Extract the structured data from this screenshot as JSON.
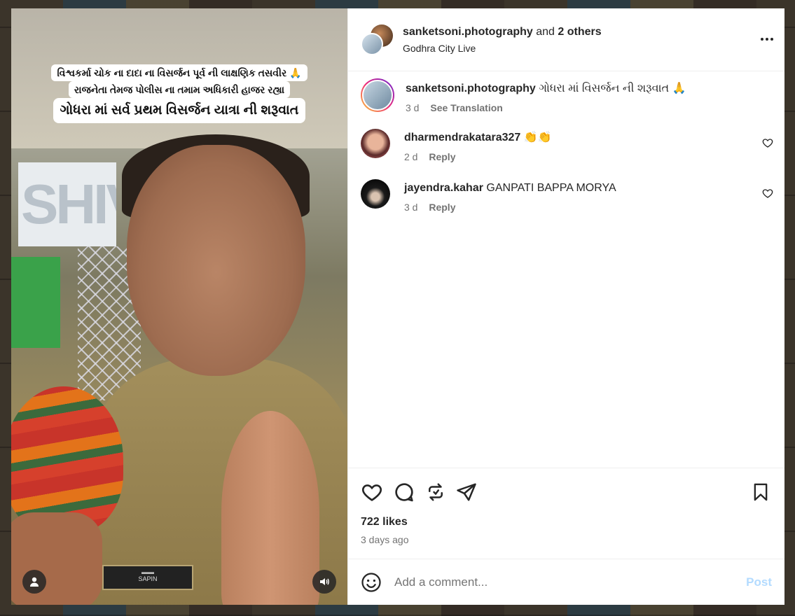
{
  "header": {
    "username": "sanketsoni.photography",
    "collab_and": "and",
    "collab_others": "2 others",
    "location": "Godhra City Live"
  },
  "media": {
    "caption_line1": "વિશ્વકર્મા ચોક ના દાદા ના વિસર્જન પૂર્વ ની લાક્ષણિક તસવીર 🙏",
    "caption_line2": "રાજનેતા તેમજ પોલીસ ના તમામ અધિકારી હાજર રહ્યા",
    "caption_line3": "ગોધરા માં સર્વ પ્રથમ વિસર્જન યાત્રા ની શરૂવાત",
    "nameplate": "SAPIN"
  },
  "caption": {
    "username": "sanketsoni.photography",
    "text": "ગોધરા માં વિસર્જન ની શરૂવાત 🙏",
    "time": "3 d",
    "translate": "See Translation"
  },
  "comments": [
    {
      "username": "dharmendrakatara327",
      "text": "👏👏",
      "time": "2 d",
      "reply": "Reply"
    },
    {
      "username": "jayendra.kahar",
      "text": "GANPATI BAPPA MORYA",
      "time": "3 d",
      "reply": "Reply"
    }
  ],
  "stats": {
    "likes": "722 likes",
    "posted": "3 days ago"
  },
  "composer": {
    "placeholder": "Add a comment...",
    "post": "Post"
  },
  "colors": {
    "post_disabled": "#b3dbff",
    "muted": "#737373",
    "text": "#262626"
  }
}
